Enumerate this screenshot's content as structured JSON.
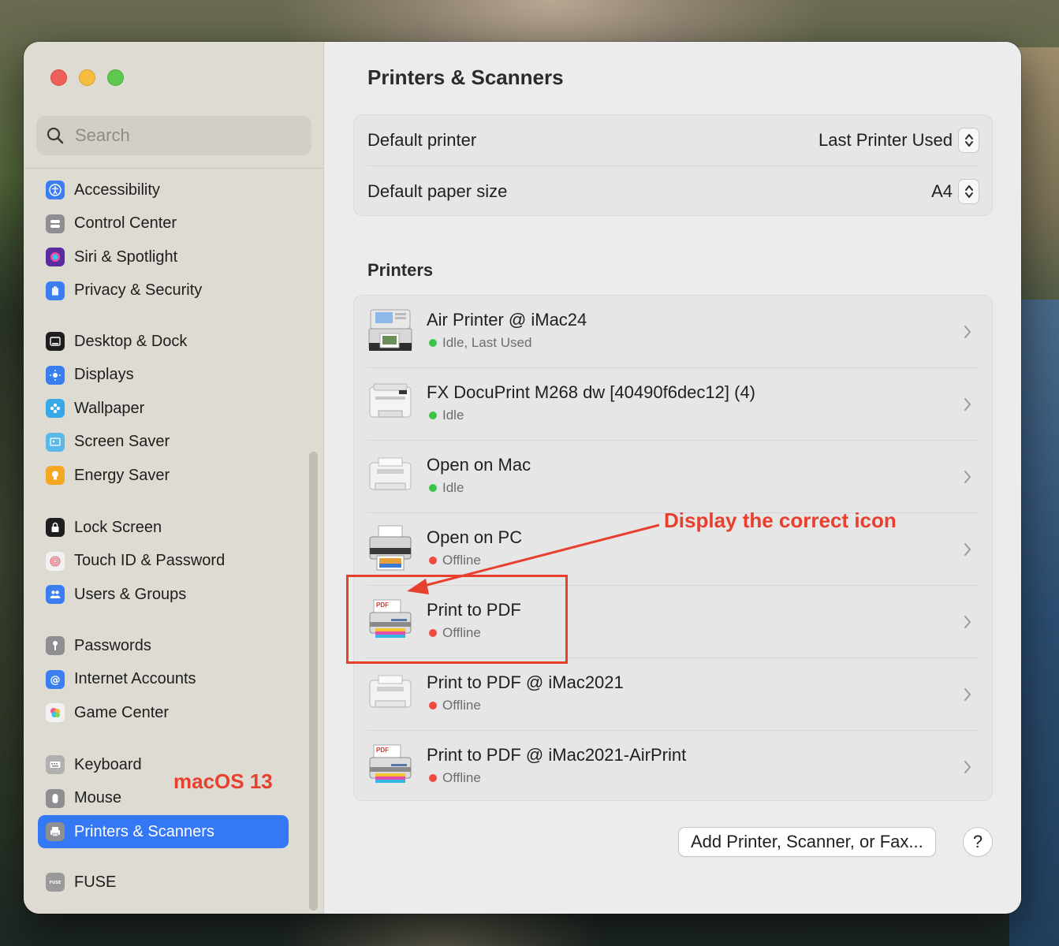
{
  "sidebar": {
    "search_placeholder": "Search",
    "groups": [
      [
        {
          "label": "Accessibility",
          "icon": "accessibility-icon",
          "color": "#3a7ef0"
        },
        {
          "label": "Control Center",
          "icon": "control-center-icon",
          "color": "#8e8e93"
        },
        {
          "label": "Siri & Spotlight",
          "icon": "siri-icon",
          "color": "#5b2ca0"
        },
        {
          "label": "Privacy & Security",
          "icon": "hand-icon",
          "color": "#3a7ef0"
        }
      ],
      [
        {
          "label": "Desktop & Dock",
          "icon": "dock-icon",
          "color": "#1e1e1e"
        },
        {
          "label": "Displays",
          "icon": "sun-icon",
          "color": "#3a7ef0"
        },
        {
          "label": "Wallpaper",
          "icon": "flower-icon",
          "color": "#35a8e8"
        },
        {
          "label": "Screen Saver",
          "icon": "screen-saver-icon",
          "color": "#5bb8e8"
        },
        {
          "label": "Energy Saver",
          "icon": "bulb-icon",
          "color": "#f5a623"
        }
      ],
      [
        {
          "label": "Lock Screen",
          "icon": "lock-icon",
          "color": "#1e1e1e"
        },
        {
          "label": "Touch ID & Password",
          "icon": "fingerprint-icon",
          "color": "#f2f2f2"
        },
        {
          "label": "Users & Groups",
          "icon": "users-icon",
          "color": "#3a7ef0"
        }
      ],
      [
        {
          "label": "Passwords",
          "icon": "key-icon",
          "color": "#8e8e93"
        },
        {
          "label": "Internet Accounts",
          "icon": "at-icon",
          "color": "#3a7ef0"
        },
        {
          "label": "Game Center",
          "icon": "game-center-icon",
          "color": "#f2f2f2"
        }
      ],
      [
        {
          "label": "Keyboard",
          "icon": "keyboard-icon",
          "color": "#b0b0b0"
        },
        {
          "label": "Mouse",
          "icon": "mouse-icon",
          "color": "#8e8e93"
        },
        {
          "label": "Printers & Scanners",
          "icon": "printer-icon",
          "color": "#8e8e93",
          "active": true
        }
      ],
      [
        {
          "label": "FUSE",
          "icon": "fuse-icon",
          "color": "#9a9a9a"
        }
      ]
    ]
  },
  "watermark": "macOS 13",
  "content": {
    "title": "Printers & Scanners",
    "defaults": [
      {
        "label": "Default printer",
        "value": "Last Printer Used"
      },
      {
        "label": "Default paper size",
        "value": "A4"
      }
    ],
    "printers_title": "Printers",
    "printers": [
      {
        "name": "Air Printer @ iMac24",
        "status": "Idle, Last Used",
        "status_color": "green",
        "icon": "multifunction-printer-icon"
      },
      {
        "name": "FX DocuPrint M268 dw [40490f6dec12] (4)",
        "status": "Idle",
        "status_color": "green",
        "icon": "laser-printer-icon"
      },
      {
        "name": "Open on Mac",
        "status": "Idle",
        "status_color": "green",
        "icon": "generic-printer-icon"
      },
      {
        "name": "Open on PC",
        "status": "Offline",
        "status_color": "red",
        "icon": "photo-printer-icon"
      },
      {
        "name": "Print to PDF",
        "status": "Offline",
        "status_color": "red",
        "icon": "pdf-printer-icon"
      },
      {
        "name": "Print to PDF @ iMac2021",
        "status": "Offline",
        "status_color": "red",
        "icon": "generic-printer-icon"
      },
      {
        "name": "Print to PDF @ iMac2021-AirPrint",
        "status": "Offline",
        "status_color": "red",
        "icon": "pdf-printer-icon"
      }
    ],
    "add_button": "Add Printer, Scanner, or Fax...",
    "help_button": "?"
  },
  "annotation": {
    "text": "Display the correct icon",
    "color": "#e8402f"
  }
}
